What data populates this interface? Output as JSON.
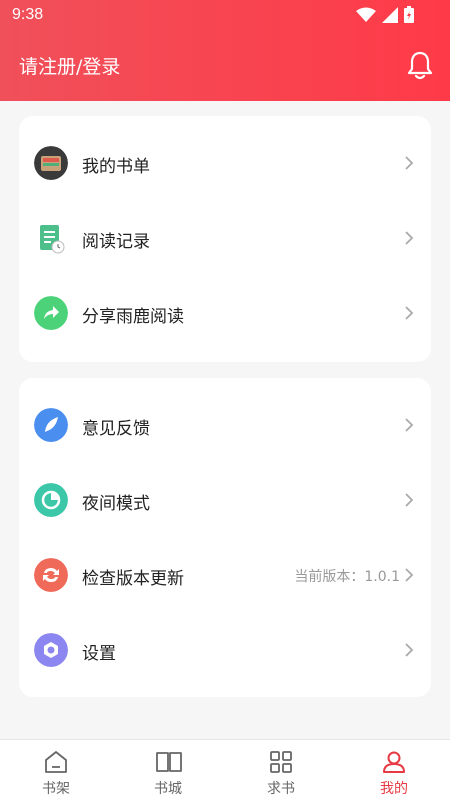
{
  "status": {
    "time": "9:38"
  },
  "header": {
    "login_text": "请注册/登录"
  },
  "card1": {
    "items": [
      {
        "label": "我的书单"
      },
      {
        "label": "阅读记录"
      },
      {
        "label": "分享雨鹿阅读"
      }
    ]
  },
  "card2": {
    "items": [
      {
        "label": "意见反馈"
      },
      {
        "label": "夜间模式"
      },
      {
        "label": "检查版本更新",
        "value": "当前版本：1.0.1"
      },
      {
        "label": "设置"
      }
    ]
  },
  "tabs": [
    {
      "label": "书架"
    },
    {
      "label": "书城"
    },
    {
      "label": "求书"
    },
    {
      "label": "我的",
      "active": true
    }
  ],
  "colors": {
    "accent": "#ff3a48",
    "tab_active": "#e83a44"
  }
}
